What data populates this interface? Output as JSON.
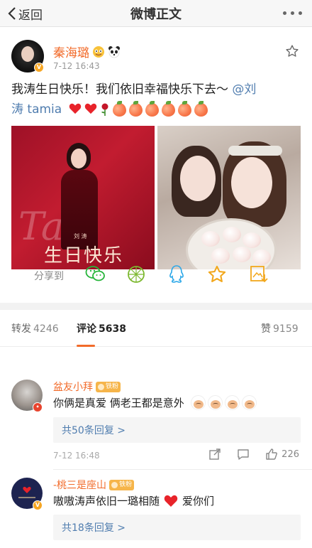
{
  "navbar": {
    "back_label": "返回",
    "title": "微博正文"
  },
  "post": {
    "author": "秦海璐",
    "time": "7-12 16:43",
    "text_line1": "我涛生日快乐！我们依旧幸福快乐下去～",
    "mention": "@刘",
    "text_line2": "涛 tamia",
    "image1": {
      "script_text": "Tao",
      "small_name": "刘 涛",
      "caption": "生日快乐"
    }
  },
  "share": {
    "label": "分享到",
    "targets": [
      "wechat",
      "moments",
      "qq",
      "favorite",
      "save-image"
    ]
  },
  "tabs": {
    "repost_label": "转发",
    "repost_count": "4246",
    "comment_label": "评论",
    "comment_count": "5638",
    "like_label": "赞",
    "like_count": "9159"
  },
  "comments": [
    {
      "name": "盆友小拜",
      "badge": "铁粉",
      "text": "你俩是真爱 俩老王都是意外",
      "reply_label": "共50条回复 >",
      "time": "7-12 16:48",
      "likes": "226"
    },
    {
      "name": "-桃三是座山",
      "badge": "铁粉",
      "text_before": "嗷嗷涛声依旧一璐相随",
      "text_after": "爱你们",
      "reply_label": "共18条回复 >"
    }
  ],
  "colors": {
    "accent": "#f26b2a",
    "link": "#507daf"
  }
}
